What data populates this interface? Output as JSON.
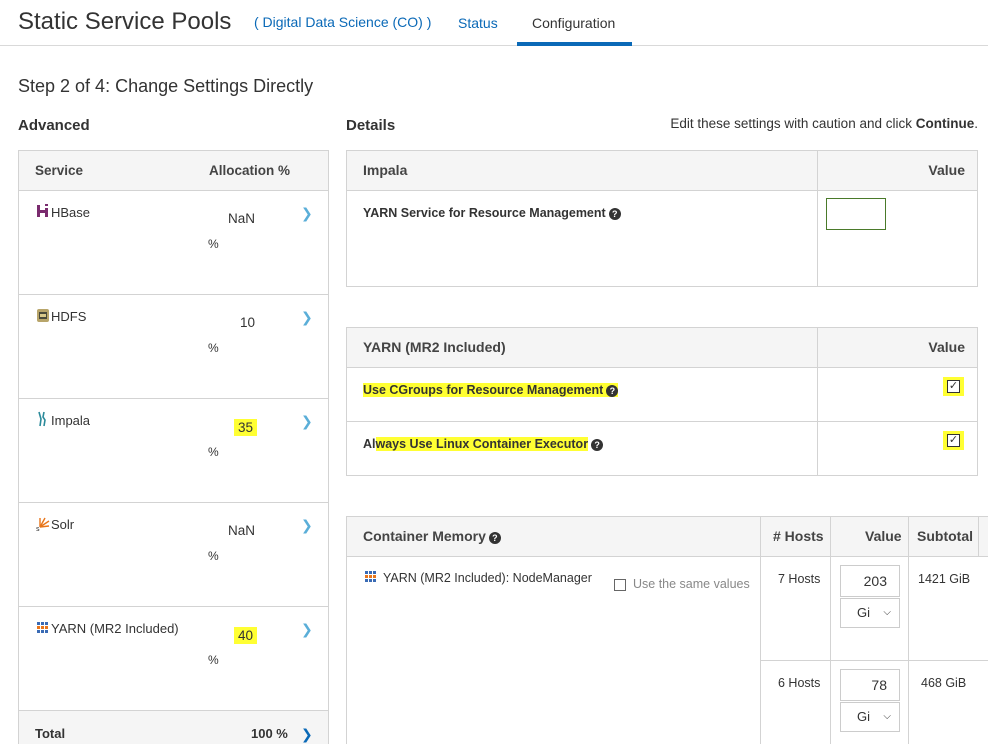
{
  "header": {
    "title": "Static Service Pools",
    "cluster": "( Digital Data Science (CO) )",
    "tabs": [
      {
        "label": "Status",
        "active": false
      },
      {
        "label": "Configuration",
        "active": true
      }
    ]
  },
  "step_title": "Step 2 of 4: Change Settings Directly",
  "advanced": {
    "heading": "Advanced",
    "columns": {
      "service": "Service",
      "allocation": "Allocation %"
    },
    "services": [
      {
        "name": "HBase",
        "value": "NaN",
        "pct": "%",
        "icon": "hbase-icon",
        "highlight": false
      },
      {
        "name": "HDFS",
        "value": "10",
        "pct": "%",
        "icon": "hdfs-icon",
        "highlight": false
      },
      {
        "name": "Impala",
        "value": "35",
        "pct": "%",
        "icon": "impala-icon",
        "highlight": true
      },
      {
        "name": "Solr",
        "value": "NaN",
        "pct": "%",
        "icon": "solr-icon",
        "highlight": false
      },
      {
        "name": "YARN (MR2 Included)",
        "value": "40",
        "pct": "%",
        "icon": "yarn-icon",
        "highlight": true
      }
    ],
    "total_label": "Total",
    "total_value": "100 %"
  },
  "details": {
    "heading": "Details",
    "hint_prefix": "Edit these settings with caution and click ",
    "hint_bold": "Continue",
    "hint_suffix": "."
  },
  "impala_table": {
    "header": "Impala",
    "value_header": "Value",
    "property": "YARN Service for Resource Management",
    "input_value": ""
  },
  "yarn_table": {
    "header": "YARN (MR2 Included)",
    "value_header": "Value",
    "rows": [
      {
        "property": "Use CGroups for Resource Management",
        "checked": true
      },
      {
        "property_plain": "Al",
        "property_hl": "ways Use Linux Container Executor",
        "checked": true
      }
    ]
  },
  "memory_table": {
    "header": "Container Memory",
    "col_hosts": "# Hosts",
    "col_value": "Value",
    "col_subtotal": "Subtotal",
    "role": "YARN (MR2 Included): NodeManager",
    "same_values_label": "Use the same values",
    "groups": [
      {
        "hosts": "7 Hosts",
        "value": "203",
        "unit": "Gi",
        "subtotal": "1421 GiB"
      },
      {
        "hosts": "6 Hosts",
        "value": "78",
        "unit": "Gi",
        "subtotal": "468 GiB"
      }
    ]
  },
  "colors": {
    "link": "#0a69b7",
    "highlight": "#ffff33",
    "border": "#d3d3d3"
  }
}
